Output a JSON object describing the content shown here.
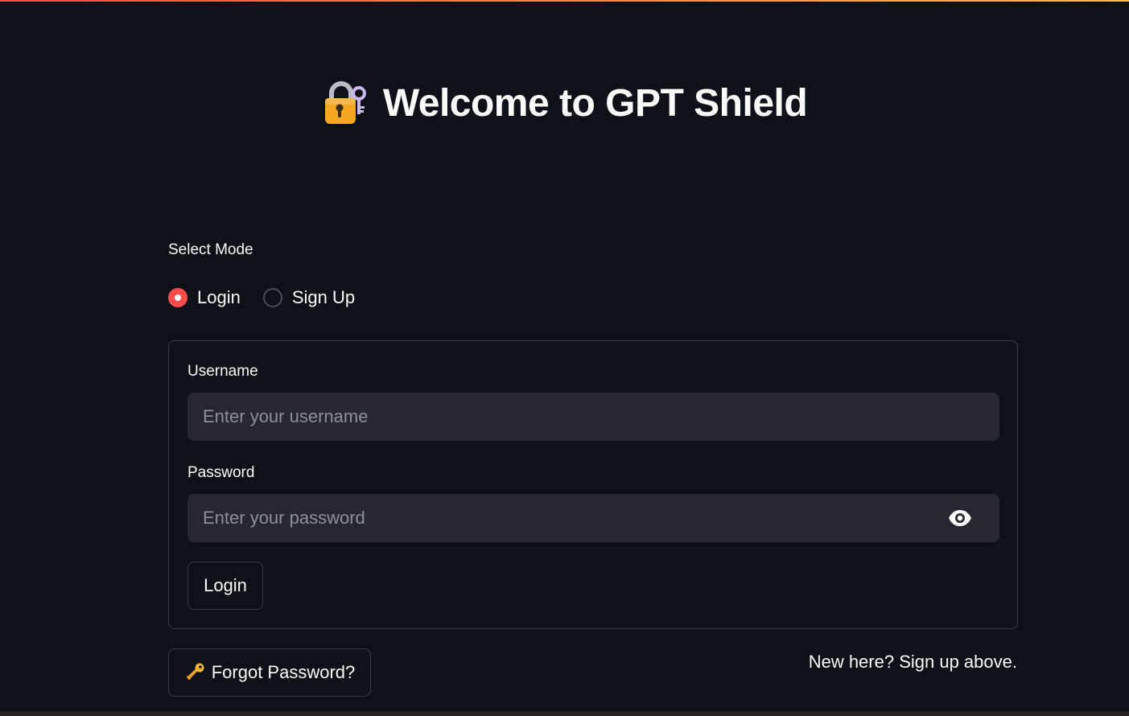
{
  "header": {
    "icon": "lock-with-key-icon",
    "title": "Welcome to GPT Shield"
  },
  "mode": {
    "label": "Select Mode",
    "options": [
      {
        "label": "Login",
        "selected": true
      },
      {
        "label": "Sign Up",
        "selected": false
      }
    ]
  },
  "login_form": {
    "username": {
      "label": "Username",
      "value": "",
      "placeholder": "Enter your username"
    },
    "password": {
      "label": "Password",
      "value": "",
      "placeholder": "Enter your password",
      "toggle_icon": "eye-icon"
    },
    "submit_label": "Login"
  },
  "footer": {
    "forgot_icon": "key-icon",
    "forgot_label": "Forgot Password?",
    "signup_hint": "New here? Sign up above."
  },
  "colors": {
    "background": "#0e1117",
    "accent": "#ff4b4b",
    "input_bg": "#262730",
    "border": "#3a3d47",
    "text": "#fafafa"
  }
}
